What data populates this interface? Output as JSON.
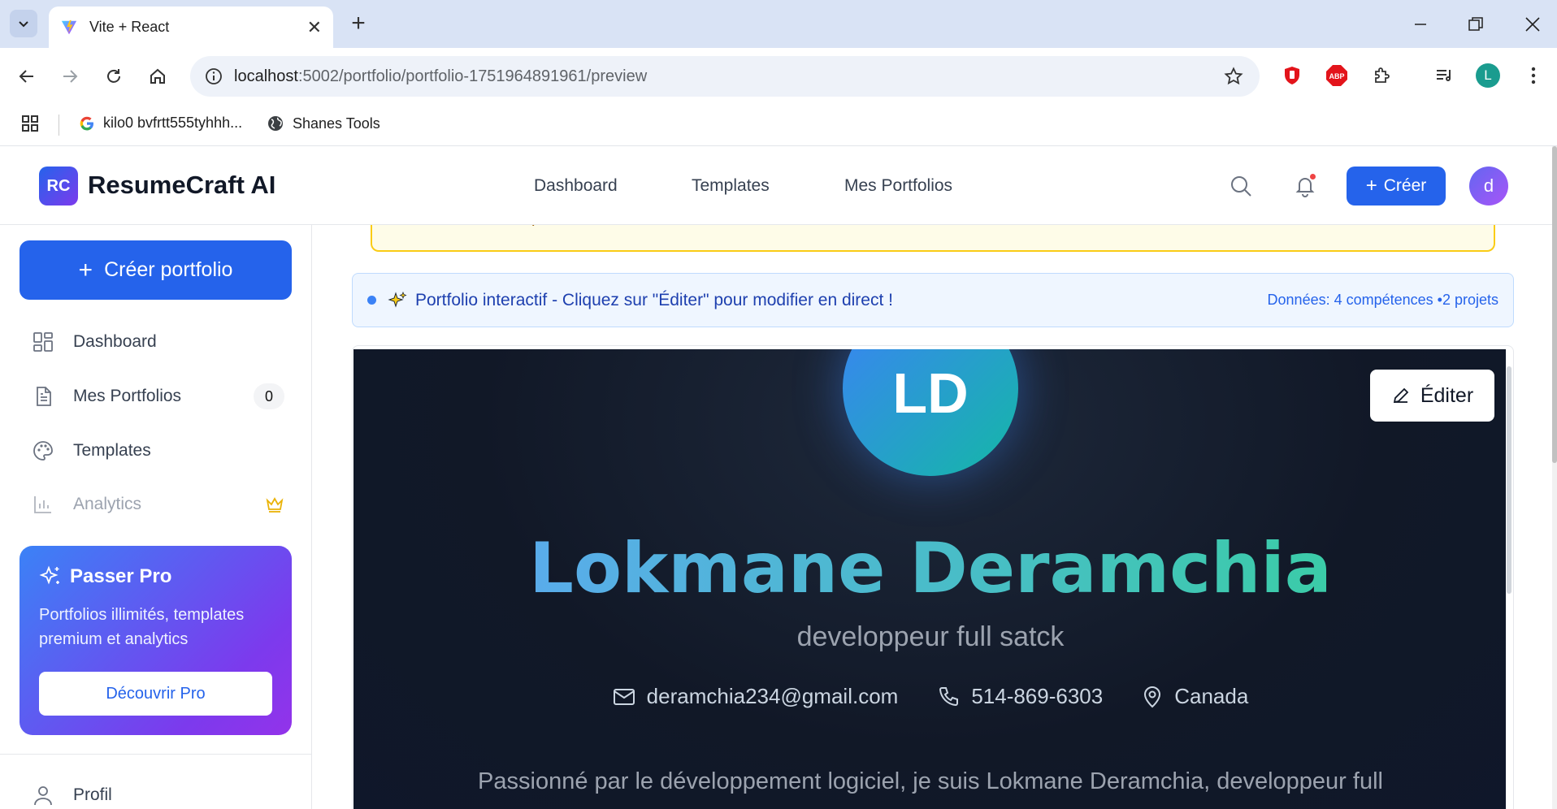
{
  "browser": {
    "tab_title": "Vite + React",
    "url_host": "localhost",
    "url_path": ":5002/portfolio/portfolio-1751964891961/preview",
    "profile_initial": "L",
    "bookmarks": [
      {
        "label": "kilo0 bvfrtt555tyhhh..."
      },
      {
        "label": "Shanes Tools"
      }
    ]
  },
  "header": {
    "logo_badge": "RC",
    "logo_text": "ResumeCraft AI",
    "nav": [
      "Dashboard",
      "Templates",
      "Mes Portfolios"
    ],
    "create_label": "Créer",
    "avatar_initial": "d"
  },
  "sidebar": {
    "create_label": "Créer portfolio",
    "items": [
      {
        "label": "Dashboard",
        "icon": "dashboard-icon"
      },
      {
        "label": "Mes Portfolios",
        "icon": "document-icon",
        "badge": "0"
      },
      {
        "label": "Templates",
        "icon": "palette-icon"
      },
      {
        "label": "Analytics",
        "icon": "chart-icon",
        "premium": true
      },
      {
        "label": "Profil",
        "icon": "user-icon"
      }
    ],
    "pro": {
      "title": "Passer Pro",
      "description": "Portfolios illimités, templates premium et analytics",
      "button": "Découvrir Pro"
    }
  },
  "main": {
    "warning_char": "p",
    "info_text": "Portfolio interactif - Cliquez sur \"Éditer\" pour modifier en direct !",
    "info_stats": "Données: 4 compétences •2 projets",
    "portfolio": {
      "initials": "LD",
      "edit_label": "Éditer",
      "name": "Lokmane Deramchia",
      "role": "developpeur full satck",
      "email": "deramchia234@gmail.com",
      "phone": "514-869-6303",
      "location": "Canada",
      "bio": "Passionné par le développement logiciel, je suis Lokmane Deramchia, developpeur full"
    }
  },
  "colors": {
    "primary": "#2563eb",
    "preview_bg": "#111827",
    "name_gradient_start": "#60a5fa",
    "name_gradient_end": "#34d399"
  }
}
